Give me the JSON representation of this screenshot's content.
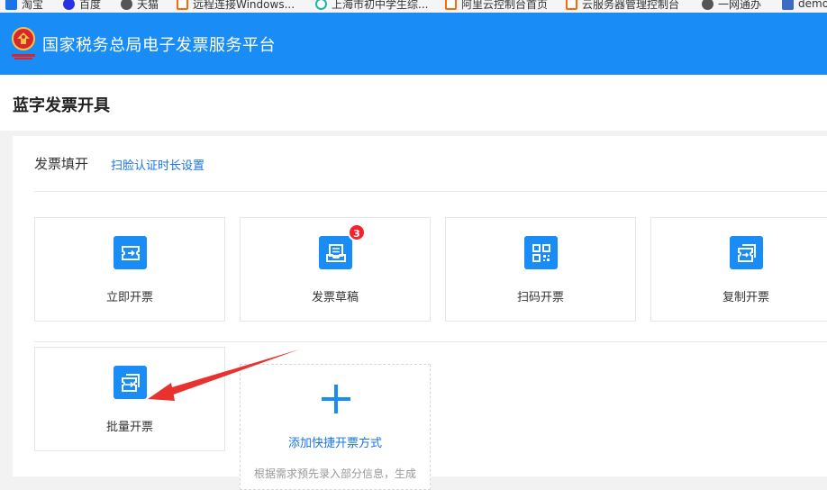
{
  "bookmarks": [
    {
      "label": "淘宝",
      "icon": "taobao-icon",
      "color": "#1a73e8"
    },
    {
      "label": "百度",
      "icon": "baidu-icon",
      "color": "#2932e1"
    },
    {
      "label": "天猫",
      "icon": "tmall-icon",
      "color": "#555555"
    },
    {
      "label": "远程连接Windows...",
      "icon": "remote-icon",
      "color": "#ff6a00"
    },
    {
      "label": "上海市初中学生综...",
      "icon": "school-icon",
      "color": "#19b8a6"
    },
    {
      "label": "阿里云控制台首页",
      "icon": "aliyun-icon",
      "color": "#ff6a00"
    },
    {
      "label": "云服务器管理控制台",
      "icon": "ecs-icon",
      "color": "#ff6a00"
    },
    {
      "label": "一网通办",
      "icon": "portal-icon",
      "color": "#555555"
    },
    {
      "label": "demo",
      "icon": "home-icon",
      "color": "#3b6bc4"
    }
  ],
  "header": {
    "title": "国家税务总局电子发票服务平台"
  },
  "page": {
    "title": "蓝字发票开具"
  },
  "section": {
    "title": "发票填开",
    "face_link": "扫脸认证时长设置"
  },
  "cards": [
    {
      "label": "立即开票",
      "icon": "instant-invoice-icon"
    },
    {
      "label": "发票草稿",
      "icon": "draft-inbox-icon",
      "badge": "3"
    },
    {
      "label": "扫码开票",
      "icon": "qr-code-icon"
    },
    {
      "label": "复制开票",
      "icon": "copy-invoice-icon"
    },
    {
      "label": "批量开票",
      "icon": "batch-invoice-icon"
    }
  ],
  "add_card": {
    "label": "添加快捷开票方式",
    "desc": "根据需求预先录入部分信息，生成"
  },
  "colors": {
    "header_bg": "#1a8cf5",
    "accent": "#1a8cf5",
    "link": "#1a73e8",
    "badge": "#f5222d",
    "annotation_arrow": "#e8322e"
  }
}
